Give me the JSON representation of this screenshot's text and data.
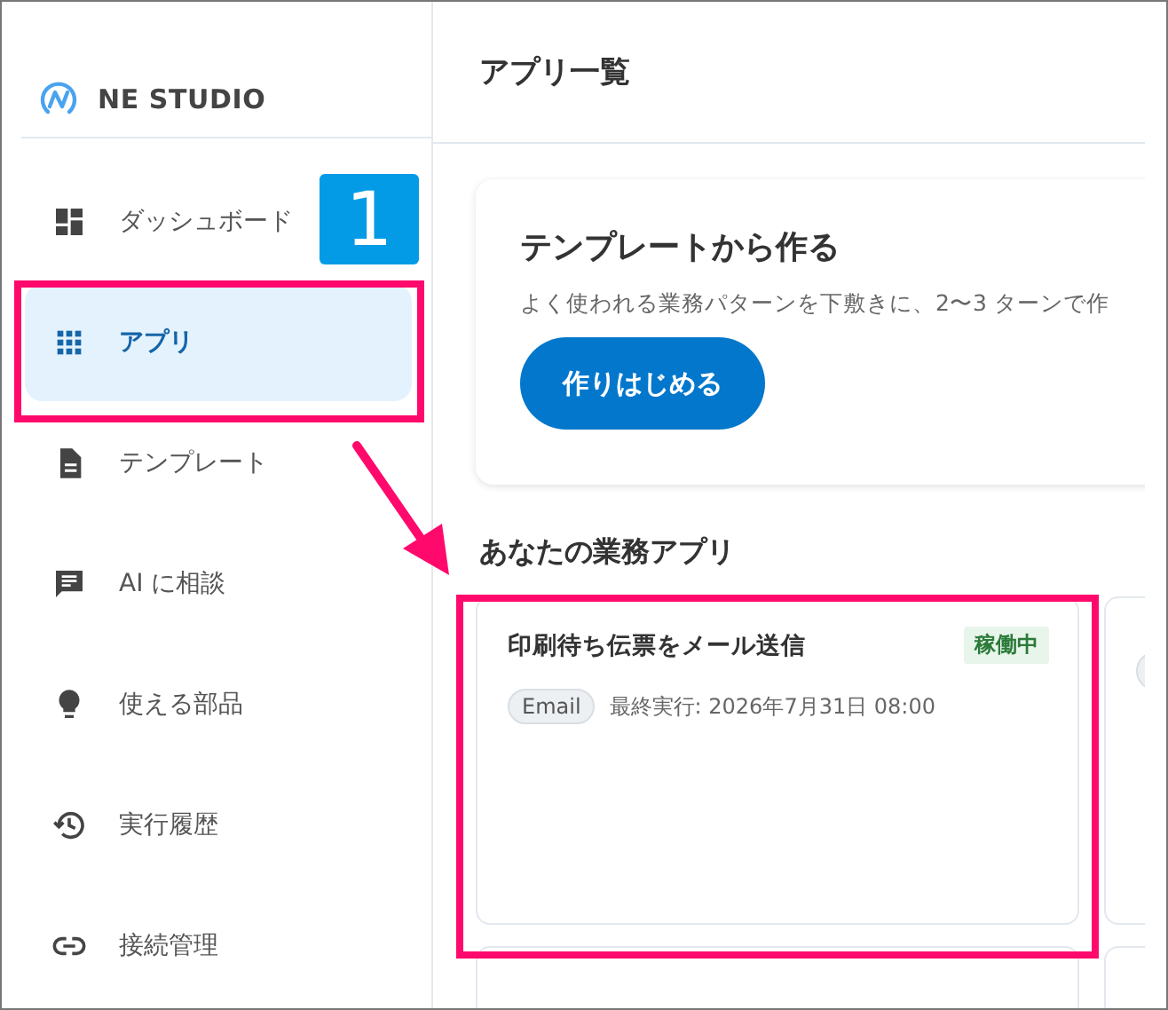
{
  "brand": {
    "name": "NE STUDIO"
  },
  "sidebar": {
    "items": [
      {
        "label": "ダッシュボード",
        "selected": false
      },
      {
        "label": "アプリ",
        "selected": true
      },
      {
        "label": "テンプレート",
        "selected": false
      },
      {
        "label": "AI に相談",
        "selected": false
      },
      {
        "label": "使える部品",
        "selected": false
      },
      {
        "label": "実行履歴",
        "selected": false
      },
      {
        "label": "接続管理",
        "selected": false
      }
    ]
  },
  "header": {
    "title": "アプリ一覧"
  },
  "template_card": {
    "title": "テンプレートから作る",
    "description": "よく使われる業務パターンを下敷きに、2〜3 ターンで作",
    "button": "作りはじめる"
  },
  "apps_section": {
    "title": "あなたの業務アプリ",
    "apps": [
      {
        "title": "印刷待ち伝票をメール送信",
        "status": "稼働中",
        "tag": "Email",
        "last_run": "最終実行: 2026年7月31日 08:00"
      }
    ]
  },
  "annotation": {
    "step": "1"
  }
}
